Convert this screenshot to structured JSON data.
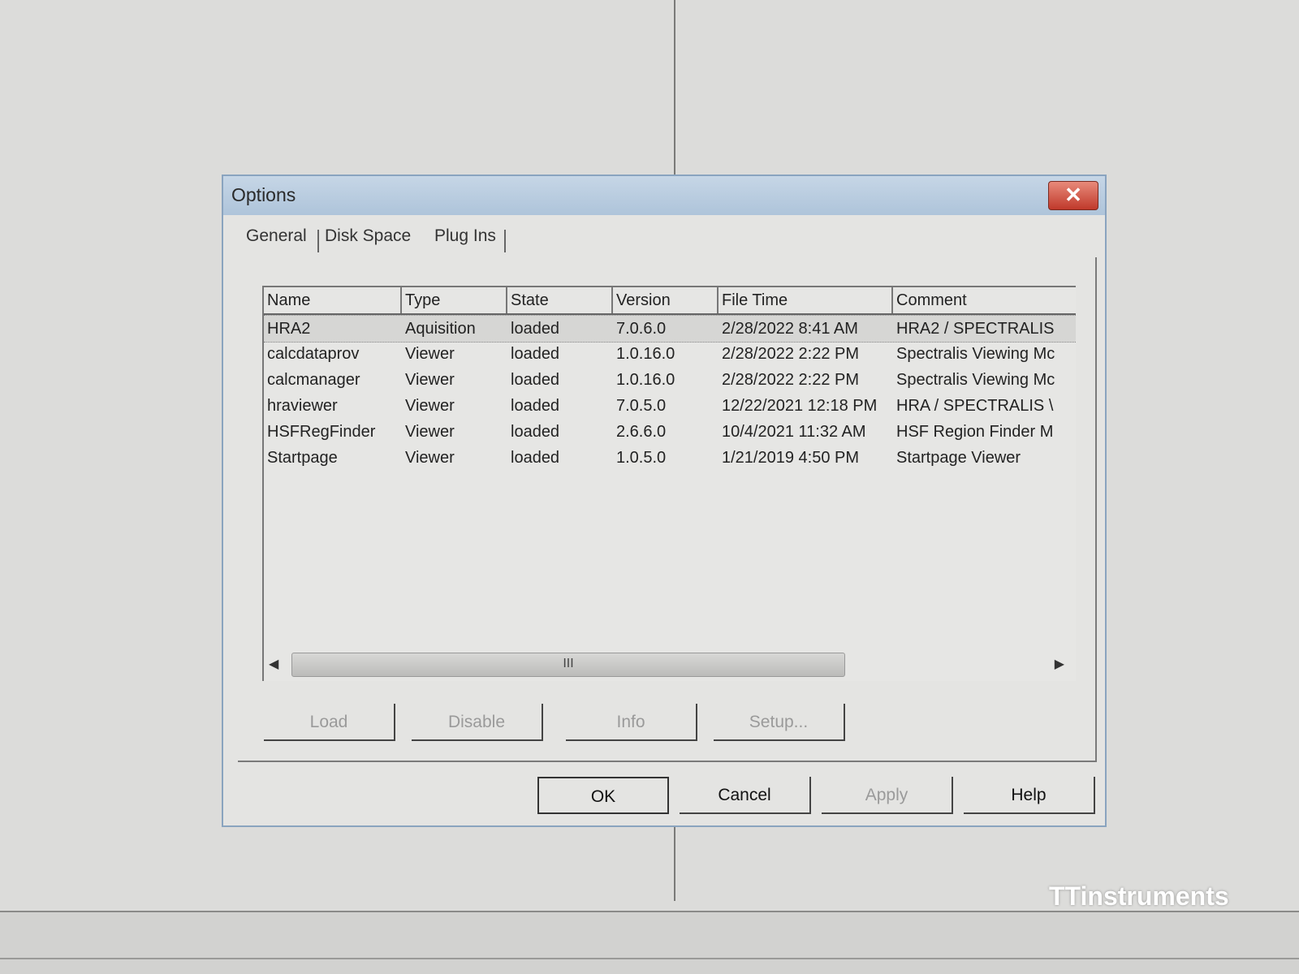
{
  "dialog": {
    "title": "Options",
    "close_glyph": "✕"
  },
  "tabs": [
    {
      "label": "General"
    },
    {
      "label": "Disk Space"
    },
    {
      "label": "Plug Ins",
      "active": true
    }
  ],
  "plugins_table": {
    "columns": [
      "Name",
      "Type",
      "State",
      "Version",
      "File Time",
      "Comment"
    ],
    "rows": [
      {
        "name": "HRA2",
        "type": "Aquisition",
        "state": "loaded",
        "version": "7.0.6.0",
        "file_time": "2/28/2022 8:41 AM",
        "comment": "HRA2 / SPECTRALIS"
      },
      {
        "name": "calcdataprov",
        "type": "Viewer",
        "state": "loaded",
        "version": "1.0.16.0",
        "file_time": "2/28/2022 2:22 PM",
        "comment": "Spectralis Viewing Mc"
      },
      {
        "name": "calcmanager",
        "type": "Viewer",
        "state": "loaded",
        "version": "1.0.16.0",
        "file_time": "2/28/2022 2:22 PM",
        "comment": "Spectralis Viewing Mc"
      },
      {
        "name": "hraviewer",
        "type": "Viewer",
        "state": "loaded",
        "version": "7.0.5.0",
        "file_time": "12/22/2021 12:18 PM",
        "comment": "HRA / SPECTRALIS \\"
      },
      {
        "name": "HSFRegFinder",
        "type": "Viewer",
        "state": "loaded",
        "version": "2.6.6.0",
        "file_time": "10/4/2021 11:32 AM",
        "comment": "HSF Region Finder M"
      },
      {
        "name": "Startpage",
        "type": "Viewer",
        "state": "loaded",
        "version": "1.0.5.0",
        "file_time": "1/21/2019 4:50 PM",
        "comment": "Startpage Viewer"
      }
    ],
    "scroll_thumb_glyph": "III"
  },
  "plugin_buttons": {
    "load": "Load",
    "disable": "Disable",
    "info": "Info",
    "setup": "Setup..."
  },
  "dialog_buttons": {
    "ok": "OK",
    "cancel": "Cancel",
    "apply": "Apply",
    "help": "Help"
  },
  "watermark": "TTinstruments"
}
